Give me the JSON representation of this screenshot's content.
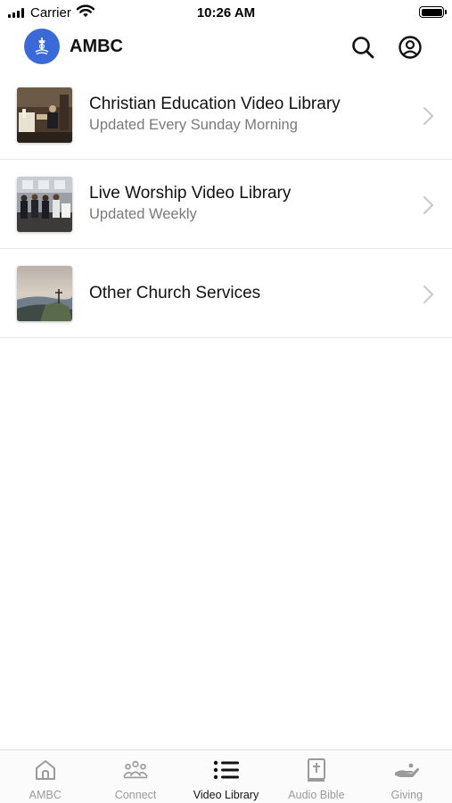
{
  "status_bar": {
    "carrier": "Carrier",
    "time": "10:26 AM",
    "battery_level": 1.0
  },
  "header": {
    "title": "AMBC",
    "logo_color": "#3a6ad8",
    "icons": [
      "search-icon",
      "account-icon"
    ]
  },
  "library": {
    "items": [
      {
        "title": "Christian Education Video Library",
        "subtitle": "Updated Every Sunday Morning",
        "thumbnail": "church-pulpit-photo"
      },
      {
        "title": "Live Worship Video Library",
        "subtitle": "Updated Weekly",
        "thumbnail": "choir-photo"
      },
      {
        "title": "Other Church Services",
        "subtitle": "",
        "thumbnail": "hilltop-cross-photo"
      }
    ]
  },
  "tab_bar": {
    "active_tab": "Video Library",
    "active_color": "#111111",
    "inactive_color": "#9a9a9a",
    "tabs": [
      {
        "label": "AMBC",
        "icon": "home-icon"
      },
      {
        "label": "Connect",
        "icon": "people-icon"
      },
      {
        "label": "Video Library",
        "icon": "list-icon"
      },
      {
        "label": "Audio Bible",
        "icon": "bible-icon"
      },
      {
        "label": "Giving",
        "icon": "giving-hand-icon"
      }
    ]
  }
}
